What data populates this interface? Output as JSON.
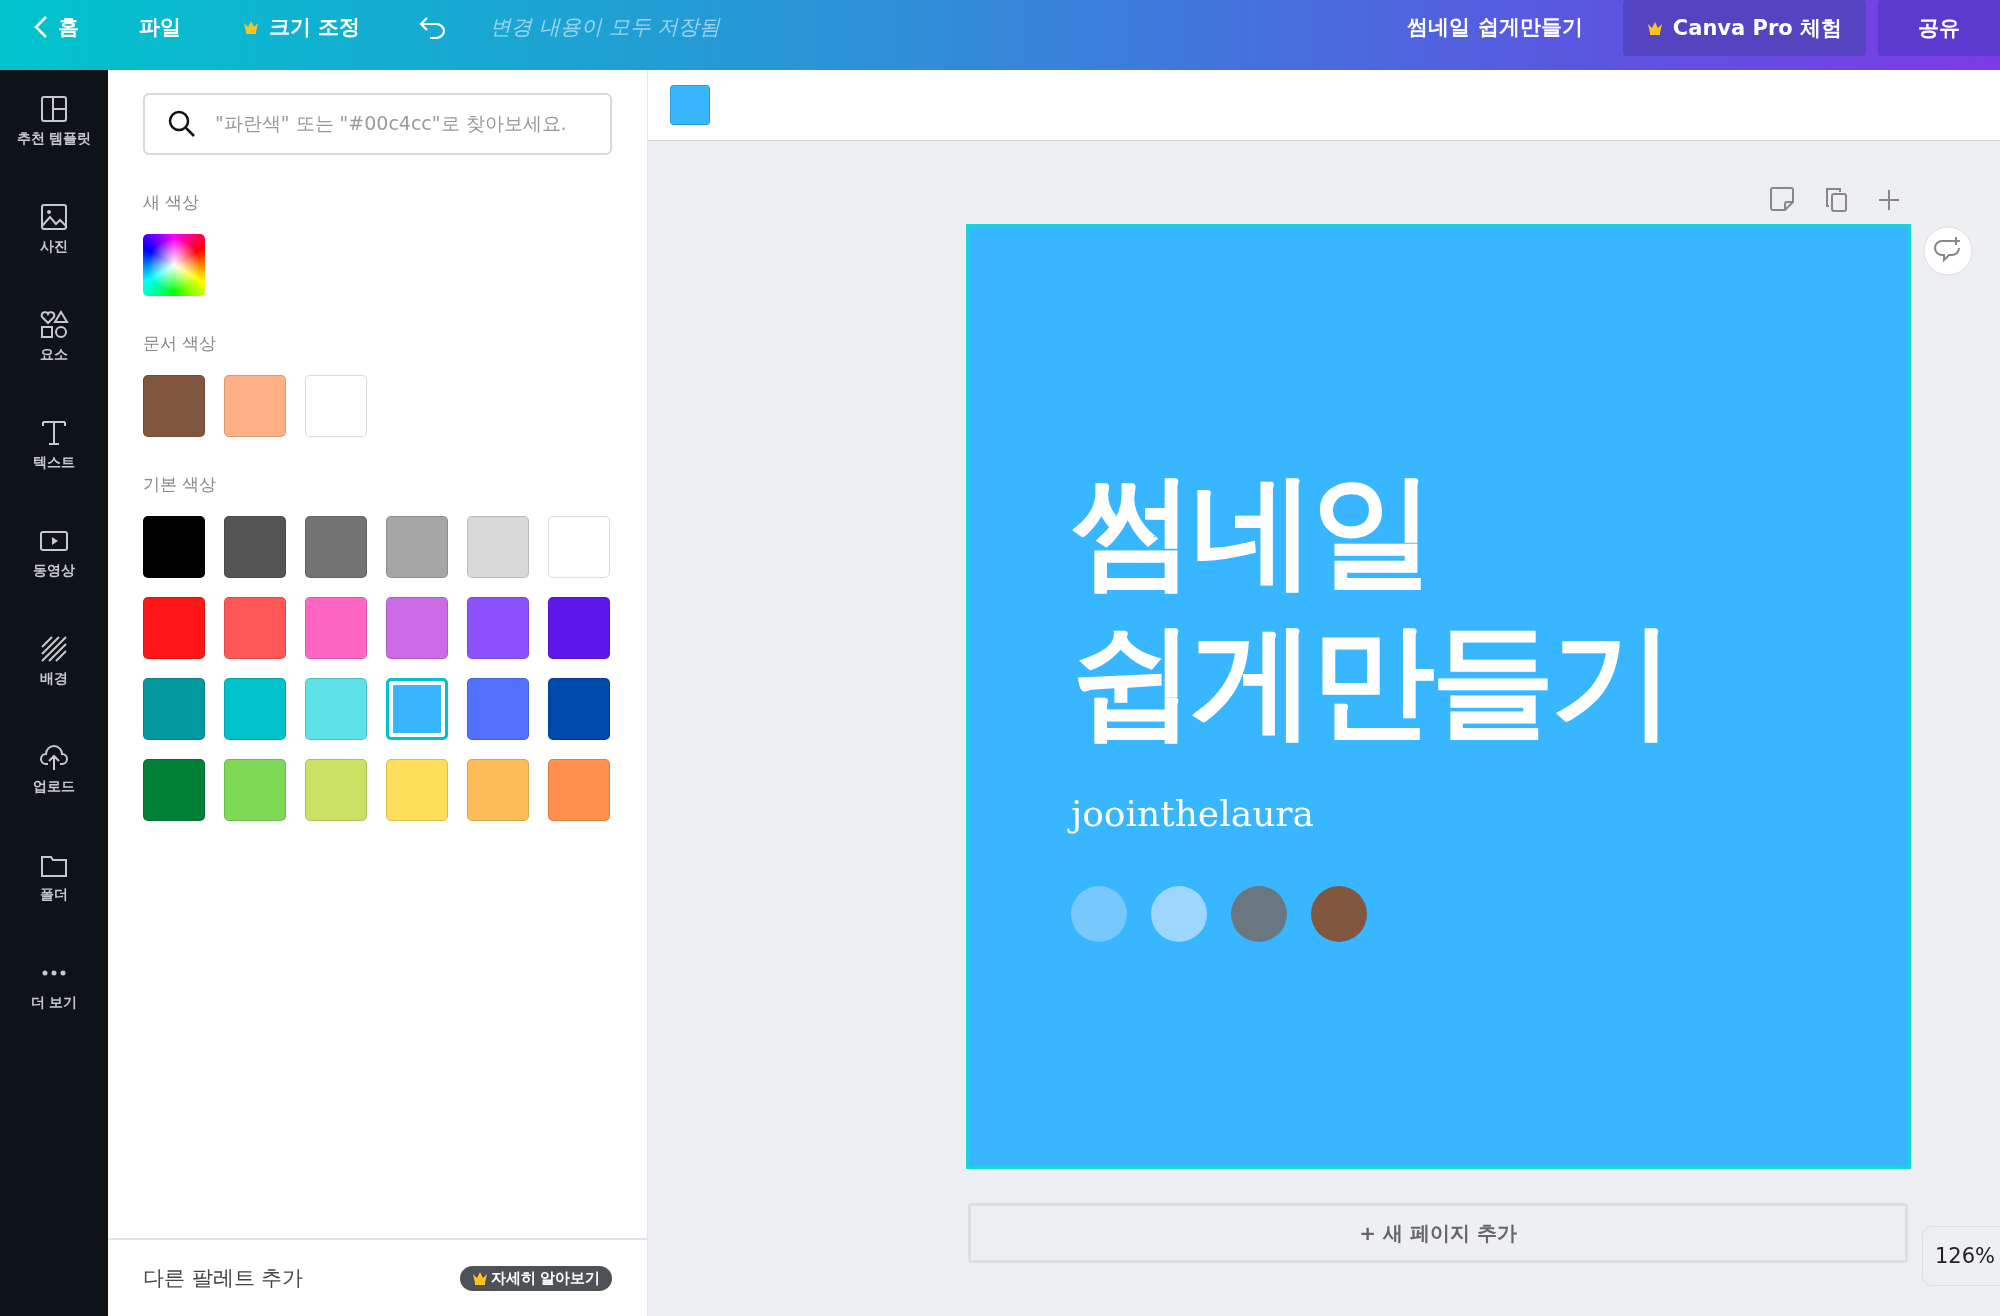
{
  "topbar": {
    "back_label": "홈",
    "file_menu": "파일",
    "resize_menu": "크기 조정",
    "save_status": "변경 내용이 모두 저장됨",
    "doc_title": "썸네일 쉽게만들기",
    "pro_button": "Canva Pro 체험",
    "share_button": "공유"
  },
  "sidebar": {
    "items": [
      {
        "label": "추천 템플릿"
      },
      {
        "label": "사진"
      },
      {
        "label": "요소"
      },
      {
        "label": "텍스트"
      },
      {
        "label": "동영상"
      },
      {
        "label": "배경"
      },
      {
        "label": "업로드"
      },
      {
        "label": "폴더"
      },
      {
        "label": "더 보기"
      }
    ]
  },
  "color_panel": {
    "search": {
      "placeholder": "\"파란색\" 또는 \"#00c4cc\"로 찾아보세요."
    },
    "sections": [
      {
        "title": "새 색상",
        "kind": "rainbow"
      },
      {
        "title": "문서 색상",
        "kind": "swatches",
        "swatches": [
          {
            "color": "#825740",
            "selected": false
          },
          {
            "color": "#ffb084",
            "selected": false
          },
          {
            "color": "#ffffff",
            "selected": false
          }
        ]
      },
      {
        "title": "기본 색상",
        "kind": "swatches",
        "swatches": [
          {
            "color": "#000000",
            "selected": false
          },
          {
            "color": "#545454",
            "selected": false
          },
          {
            "color": "#737373",
            "selected": false
          },
          {
            "color": "#a6a6a6",
            "selected": false
          },
          {
            "color": "#d9d9d9",
            "selected": false
          },
          {
            "color": "#ffffff",
            "selected": false
          },
          {
            "color": "#ff1616",
            "selected": false
          },
          {
            "color": "#ff5757",
            "selected": false
          },
          {
            "color": "#ff66c4",
            "selected": false
          },
          {
            "color": "#cb6ce6",
            "selected": false
          },
          {
            "color": "#8c52ff",
            "selected": false
          },
          {
            "color": "#5e17eb",
            "selected": false
          },
          {
            "color": "#03989e",
            "selected": false
          },
          {
            "color": "#00c2cb",
            "selected": false
          },
          {
            "color": "#5ce1e6",
            "selected": false
          },
          {
            "color": "#38b6ff",
            "selected": true
          },
          {
            "color": "#5271ff",
            "selected": false
          },
          {
            "color": "#004aad",
            "selected": false
          },
          {
            "color": "#008037",
            "selected": false
          },
          {
            "color": "#7ed957",
            "selected": false
          },
          {
            "color": "#c9e265",
            "selected": false
          },
          {
            "color": "#ffde59",
            "selected": false
          },
          {
            "color": "#ffbd59",
            "selected": false
          },
          {
            "color": "#ff914d",
            "selected": false
          }
        ]
      }
    ],
    "footer": {
      "label": "다른 팔레트 추가",
      "badge": "자세히 알아보기"
    }
  },
  "canvas": {
    "toolbar_swatch": {
      "color": "#38b6ff"
    },
    "design": {
      "title_lines": [
        "썸네일",
        "쉽게만들기"
      ],
      "author": "joointhelaura",
      "dots": [
        {
          "color": "#77c8ff"
        },
        {
          "color": "#9dd7ff"
        },
        {
          "color": "#6a7780"
        },
        {
          "color": "#82573f"
        }
      ]
    },
    "add_page_button": "+ 새 페이지 추가",
    "zoom": "126%"
  }
}
